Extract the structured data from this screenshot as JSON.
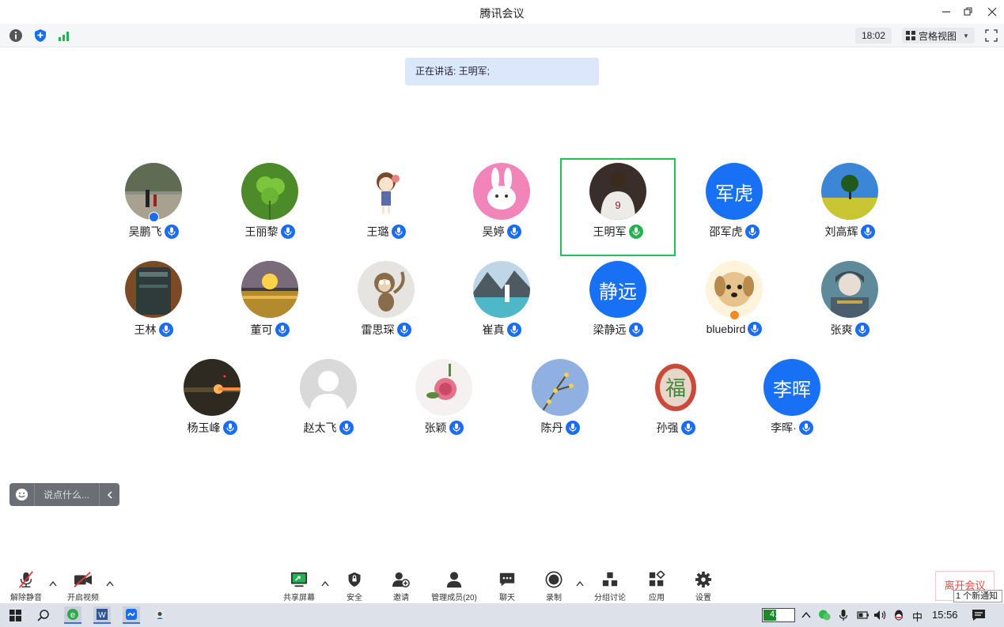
{
  "window": {
    "title": "腾讯会议",
    "time": "18:02",
    "view_mode": "宫格视图"
  },
  "speaking": "正在讲话: 王明军;",
  "participants": [
    {
      "name": "吴鹏飞",
      "avatar_type": "photo-path-people",
      "mic": "on",
      "badge": "host"
    },
    {
      "name": "王丽黎",
      "avatar_type": "photo-clover",
      "mic": "on"
    },
    {
      "name": "王璐",
      "avatar_type": "cartoon-girl",
      "mic": "on"
    },
    {
      "name": "吴婷",
      "avatar_type": "cartoon-rabbit",
      "mic": "on"
    },
    {
      "name": "王明军",
      "avatar_type": "photo-basketball-player",
      "mic": "speaking",
      "active": true
    },
    {
      "name": "邵军虎",
      "avatar_type": "text",
      "avatar_text": "军虎",
      "mic": "on"
    },
    {
      "name": "刘高辉",
      "avatar_type": "photo-tree-field",
      "mic": "on"
    },
    {
      "name": "王林",
      "avatar_type": "photo-cup",
      "mic": "on"
    },
    {
      "name": "董可",
      "avatar_type": "photo-sunset-sea",
      "mic": "on"
    },
    {
      "name": "雷思琛",
      "avatar_type": "cartoon-monkey",
      "mic": "on"
    },
    {
      "name": "崔真",
      "avatar_type": "photo-mountain-lake",
      "mic": "on"
    },
    {
      "name": "梁静远",
      "avatar_type": "text",
      "avatar_text": "静远",
      "mic": "on"
    },
    {
      "name": "bluebird",
      "avatar_type": "photo-puppy",
      "mic": "on",
      "badge": "cohost"
    },
    {
      "name": "张爽",
      "avatar_type": "cartoon-anime",
      "mic": "on"
    },
    {
      "name": "杨玉峰",
      "avatar_type": "photo-dark-light",
      "mic": "on"
    },
    {
      "name": "赵太飞",
      "avatar_type": "default-silhouette",
      "mic": "on"
    },
    {
      "name": "张颖",
      "avatar_type": "photo-rose",
      "mic": "on"
    },
    {
      "name": "陈丹",
      "avatar_type": "photo-blossom-sky",
      "mic": "on"
    },
    {
      "name": "孙强",
      "avatar_type": "photo-fu-character",
      "mic": "on"
    },
    {
      "name": "李晖·",
      "avatar_type": "text",
      "avatar_text": "李晖",
      "mic": "on"
    }
  ],
  "chat": {
    "placeholder": "说点什么..."
  },
  "toolbar": {
    "unmute": "解除静音",
    "start_video": "开启视频",
    "share_screen": "共享屏幕",
    "security": "安全",
    "invite": "邀请",
    "manage_members": "管理成员(20)",
    "chat": "聊天",
    "record": "录制",
    "breakout": "分组讨论",
    "apps": "应用",
    "settings": "设置",
    "leave": "离开会议"
  },
  "notification": "1 个新通知",
  "taskbar": {
    "battery": "41%",
    "battery_level": 0.41,
    "ime": "中",
    "clock": "15:56"
  },
  "colors": {
    "accent_blue": "#1a6cf0",
    "active_green": "#22c05a",
    "leave_red": "#e84a4a"
  }
}
